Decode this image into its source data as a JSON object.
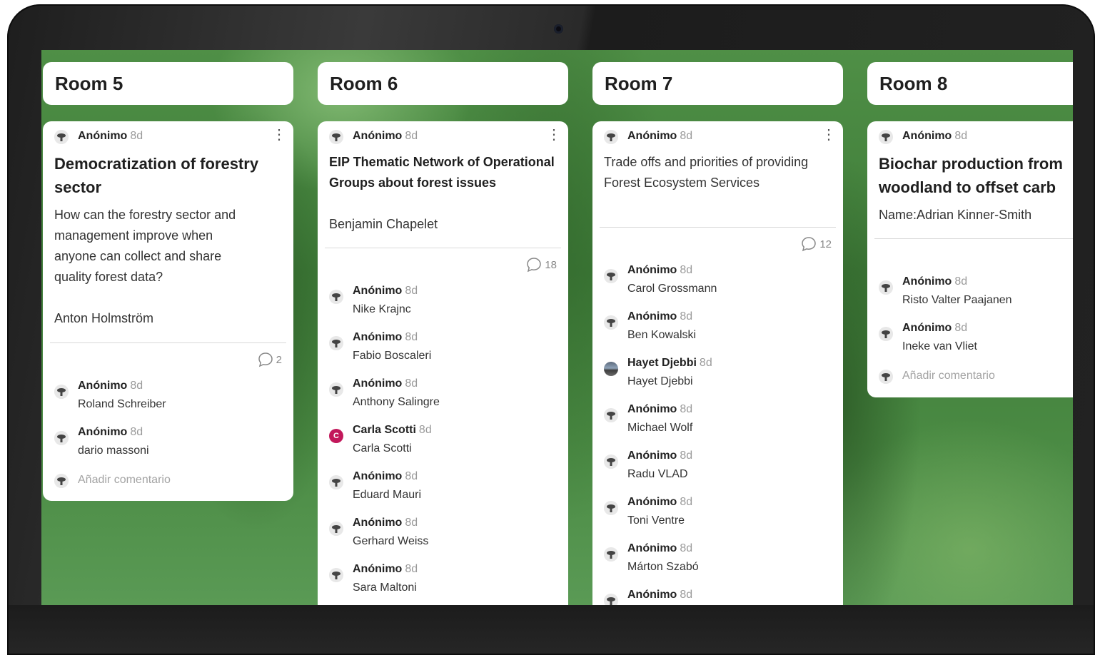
{
  "time_ago": "8d",
  "add_comment_label": "Añadir comentario",
  "rooms": [
    {
      "title": "Room 5",
      "post": {
        "author": "Anónimo",
        "title": "Democratization of forestry sector",
        "body": "How can the forestry sector and\nmanagement improve when\nanyone can collect and share\nquality forest data?\n\nAnton Holmström",
        "comment_count": "2"
      },
      "comments": [
        {
          "author": "Anónimo",
          "text": "Roland Schreiber"
        },
        {
          "author": "Anónimo",
          "text": "dario massoni"
        }
      ]
    },
    {
      "title": "Room 6",
      "post": {
        "author": "Anónimo",
        "title": "EIP Thematic Network of Operational Groups  about forest issues",
        "body": "Benjamin Chapelet",
        "comment_count": "18"
      },
      "comments": [
        {
          "author": "Anónimo",
          "text": "Nike Krajnc"
        },
        {
          "author": "Anónimo",
          "text": "Fabio Boscaleri"
        },
        {
          "author": "Anónimo",
          "text": "Anthony Salingre"
        },
        {
          "author": "Carla Scotti",
          "text": "Carla Scotti",
          "avatar_initial": "C",
          "avatar_color": "#c2185b"
        },
        {
          "author": "Anónimo",
          "text": "Eduard Mauri"
        },
        {
          "author": "Anónimo",
          "text": "Gerhard Weiss"
        },
        {
          "author": "Anónimo",
          "text": "Sara Maltoni"
        }
      ]
    },
    {
      "title": "Room 7",
      "post": {
        "author": "Anónimo",
        "title": "Trade offs and priorities of providing Forest Ecosystem Services",
        "body": "",
        "comment_count": "12"
      },
      "comments": [
        {
          "author": "Anónimo",
          "text": "Carol Grossmann"
        },
        {
          "author": "Anónimo",
          "text": "Ben Kowalski"
        },
        {
          "author": "Hayet Djebbi",
          "text": "Hayet Djebbi",
          "avatar_photo": true
        },
        {
          "author": "Anónimo",
          "text": "Michael Wolf"
        },
        {
          "author": "Anónimo",
          "text": "Radu VLAD"
        },
        {
          "author": "Anónimo",
          "text": "Toni Ventre"
        },
        {
          "author": "Anónimo",
          "text": "Márton Szabó"
        },
        {
          "author": "Anónimo",
          "text": ""
        }
      ]
    },
    {
      "title": "Room 8",
      "post": {
        "author": "Anónimo",
        "title": "Biochar production from woodland to offset carb",
        "body": "Name:Adrian Kinner-Smith",
        "comment_count": ""
      },
      "comments": [
        {
          "author": "Anónimo",
          "text": "Risto Valter Paajanen"
        },
        {
          "author": "Anónimo",
          "text": "Ineke van Vliet"
        }
      ]
    }
  ]
}
